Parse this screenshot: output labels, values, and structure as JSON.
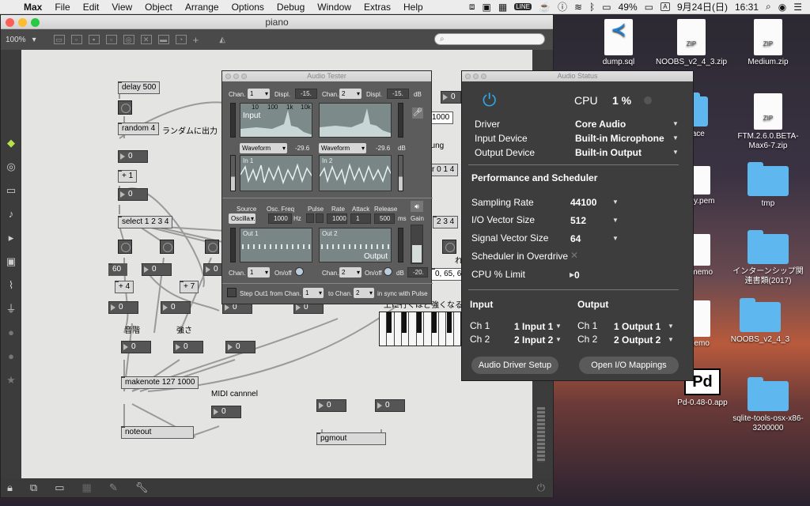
{
  "menubar": {
    "app": "Max",
    "items": [
      "File",
      "Edit",
      "View",
      "Object",
      "Arrange",
      "Options",
      "Debug",
      "Window",
      "Extras",
      "Help"
    ],
    "battery": "49%",
    "input_source": "A",
    "date": "9月24日(日)",
    "time": "16:31"
  },
  "desktop": {
    "icons": [
      {
        "label": "dump.sql",
        "type": "file"
      },
      {
        "label": "NOOBS_v2_4_3.zip",
        "type": "zip"
      },
      {
        "label": "Medium.zip",
        "type": "zip"
      },
      {
        "label": "FTM.2.6.0.BETA-Max6-7.zip",
        "type": "zip"
      },
      {
        "label": "pace",
        "type": "folder"
      },
      {
        "label": "ruby.pem",
        "type": "file"
      },
      {
        "label": "tmp",
        "type": "folder"
      },
      {
        "label": "インターンシップ関連書類(2017)",
        "type": "folder"
      },
      {
        "label": "k-memo",
        "type": "file"
      },
      {
        "label": "memo",
        "type": "file"
      },
      {
        "label": "NOOBS_v2_4_3",
        "type": "folder"
      },
      {
        "label": "Pd-0.48-0.app",
        "type": "app"
      },
      {
        "label": "sqlite-tools-osx-x86-3200000",
        "type": "folder"
      }
    ],
    "zip_tag": "ZIP",
    "pd_text": "Pd"
  },
  "window": {
    "title": "piano",
    "zoom": "100%"
  },
  "patch": {
    "objects": {
      "delay": "delay 500",
      "random": "random 4",
      "select": "select 1 2 3 4",
      "plus1": "+ 1",
      "plus4": "+ 4",
      "plus7": "+ 7",
      "makenote": "makenote 127 1000",
      "noteout": "noteout",
      "pgmout": "pgmout"
    },
    "numbers": {
      "n_zero": "0",
      "n_sixty": "60"
    },
    "comments": {
      "random": "ランダムに出力",
      "pitch": "音階",
      "velocity": "強さ",
      "midi": "MIDI cannnel",
      "higher": "上に行くほど強くなる",
      "bung": "bung",
      "r014": "r 0 1 4",
      "n234": "2 3 4",
      "n65": "0, 65, 69",
      "kanji": "れ"
    }
  },
  "tester": {
    "title": "Audio Tester",
    "chan_label": "Chan.",
    "displ_label": "Displ.",
    "db": "dB",
    "hz": "Hz",
    "ms": "ms",
    "in_chan1": "1",
    "in_chan2": "2",
    "displ1": "-15.",
    "displ2": "-15.",
    "freq_ticks": [
      "10",
      "100",
      "1k",
      "10k"
    ],
    "input_label": "Input",
    "waveform": "Waveform",
    "wave_val": "-29.6",
    "in1": "In 1",
    "in2": "In 2",
    "source_label": "Source",
    "oscfreq_label": "Osc. Freq",
    "pulse_label": "Pulse",
    "rate_label": "Rate",
    "attack_label": "Attack",
    "release_label": "Release",
    "source": "Oscilla...",
    "freq": "1000",
    "rate": "1000",
    "attack": "1",
    "release": "500",
    "gain_label": "Gain",
    "out1": "Out 1",
    "out2": "Out 2",
    "output_label": "Output",
    "onoff": "On/off",
    "out_chan1": "1",
    "out_chan2": "2",
    "gain_db": "-20.",
    "step_label": "Step Out1 from Chan.",
    "step_from": "1",
    "to_chan_label": "to Chan.",
    "step_to": "2",
    "sync_label": "in sync with Pulse"
  },
  "status": {
    "title": "Audio Status",
    "cpu_label": "CPU",
    "cpu_value": "1 %",
    "rows": [
      {
        "label": "Driver",
        "value": "Core Audio"
      },
      {
        "label": "Input Device",
        "value": "Built-in Microphone"
      },
      {
        "label": "Output Device",
        "value": "Built-in Output"
      }
    ],
    "perf_title": "Performance and Scheduler",
    "perf": [
      {
        "label": "Sampling Rate",
        "value": "44100"
      },
      {
        "label": "I/O Vector Size",
        "value": "512"
      },
      {
        "label": "Signal Vector Size",
        "value": "64"
      }
    ],
    "overdrive_label": "Scheduler in Overdrive",
    "cpu_limit_label": "CPU % Limit",
    "cpu_limit": "0",
    "input_title": "Input",
    "output_title": "Output",
    "in_ch1": "Ch 1",
    "in_ch1_val": "1 Input 1",
    "in_ch2": "Ch 2",
    "in_ch2_val": "2 Input 2",
    "out_ch1": "Ch 1",
    "out_ch1_val": "1 Output 1",
    "out_ch2": "Ch 2",
    "out_ch2_val": "2 Output 2",
    "btn_driver": "Audio Driver Setup",
    "btn_io": "Open I/O Mappings"
  },
  "colors": {
    "accent": "#2ea8e6",
    "canvas": "#e4e4e2",
    "panel": "#3d3d3d"
  }
}
